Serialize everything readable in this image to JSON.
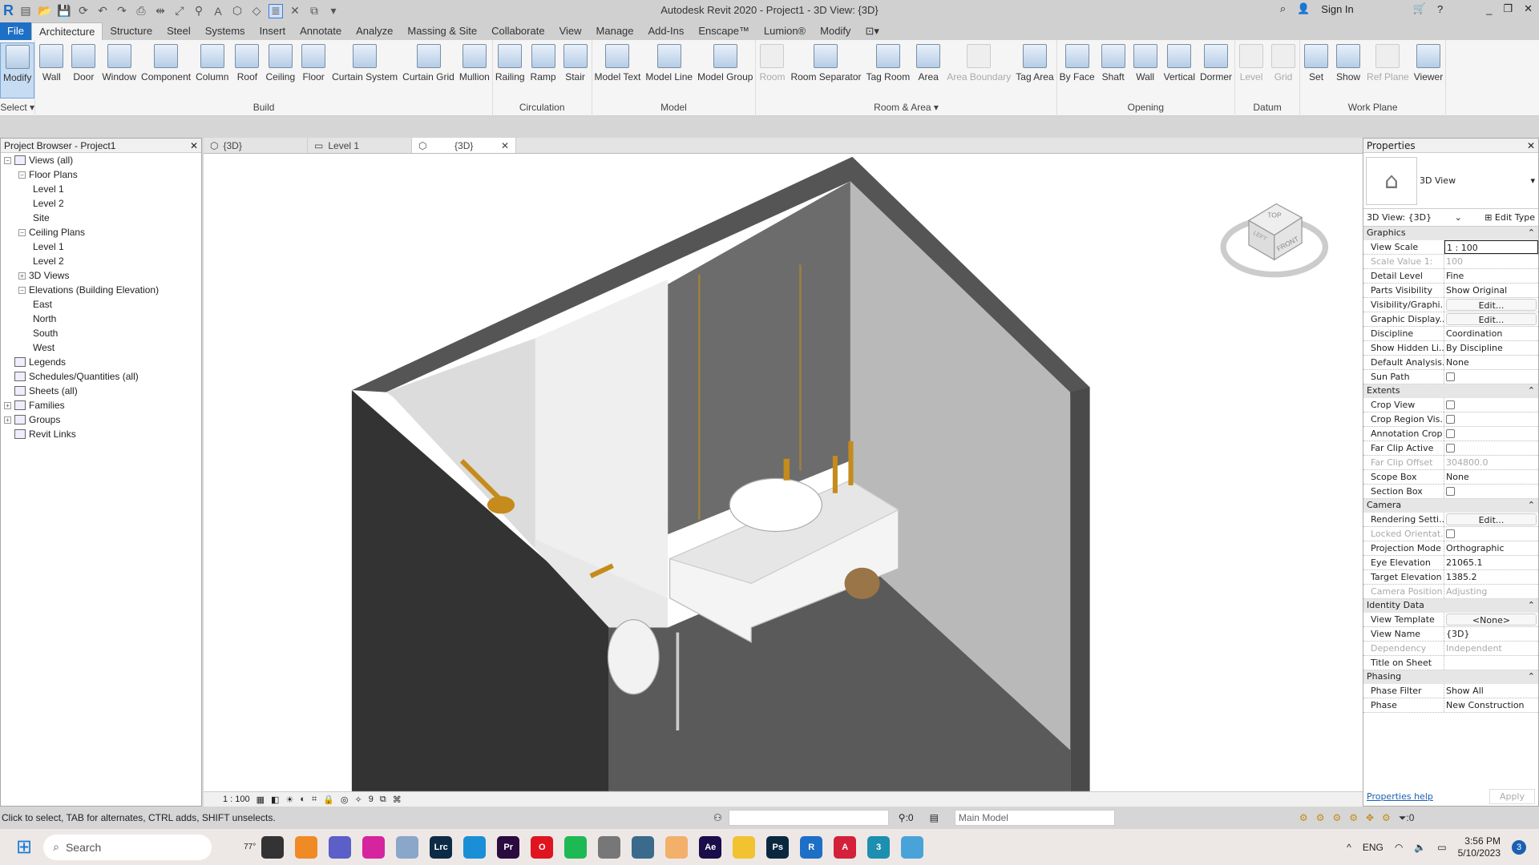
{
  "app_title": "Autodesk Revit 2020 - Project1 - 3D View: {3D}",
  "title_right": {
    "sign_in": "Sign In"
  },
  "tabs": [
    "File",
    "Architecture",
    "Structure",
    "Steel",
    "Systems",
    "Insert",
    "Annotate",
    "Analyze",
    "Massing & Site",
    "Collaborate",
    "View",
    "Manage",
    "Add-Ins",
    "Enscape™",
    "Lumion®",
    "Modify"
  ],
  "active_tab": "Architecture",
  "ribbon_groups": [
    {
      "label": "Select ▾",
      "items": [
        {
          "label": "Modify",
          "sel": true
        }
      ]
    },
    {
      "label": "Build",
      "items": [
        {
          "label": "Wall"
        },
        {
          "label": "Door"
        },
        {
          "label": "Window"
        },
        {
          "label": "Component"
        },
        {
          "label": "Column"
        },
        {
          "label": "Roof"
        },
        {
          "label": "Ceiling"
        },
        {
          "label": "Floor"
        },
        {
          "label": "Curtain System"
        },
        {
          "label": "Curtain Grid"
        },
        {
          "label": "Mullion"
        }
      ]
    },
    {
      "label": "Circulation",
      "items": [
        {
          "label": "Railing"
        },
        {
          "label": "Ramp"
        },
        {
          "label": "Stair"
        }
      ]
    },
    {
      "label": "Model",
      "items": [
        {
          "label": "Model Text"
        },
        {
          "label": "Model Line"
        },
        {
          "label": "Model Group"
        }
      ]
    },
    {
      "label": "Room & Area ▾",
      "items": [
        {
          "label": "Room",
          "dis": true
        },
        {
          "label": "Room Separator"
        },
        {
          "label": "Tag Room"
        },
        {
          "label": "Area"
        },
        {
          "label": "Area Boundary",
          "dis": true
        },
        {
          "label": "Tag Area"
        }
      ]
    },
    {
      "label": "Opening",
      "items": [
        {
          "label": "By Face"
        },
        {
          "label": "Shaft"
        },
        {
          "label": "Wall"
        },
        {
          "label": "Vertical"
        },
        {
          "label": "Dormer"
        }
      ]
    },
    {
      "label": "Datum",
      "items": [
        {
          "label": "Level",
          "dis": true
        },
        {
          "label": "Grid",
          "dis": true
        }
      ]
    },
    {
      "label": "Work Plane",
      "items": [
        {
          "label": "Set"
        },
        {
          "label": "Show"
        },
        {
          "label": "Ref Plane",
          "dis": true
        },
        {
          "label": "Viewer"
        }
      ]
    }
  ],
  "project_browser": {
    "title": "Project Browser - Project1",
    "items": [
      {
        "label": "Views (all)",
        "level": 0,
        "tog": "−"
      },
      {
        "label": "Floor Plans",
        "level": 1,
        "tog": "−"
      },
      {
        "label": "Level 1",
        "level": 2
      },
      {
        "label": "Level 2",
        "level": 2
      },
      {
        "label": "Site",
        "level": 2
      },
      {
        "label": "Ceiling Plans",
        "level": 1,
        "tog": "−"
      },
      {
        "label": "Level 1",
        "level": 2
      },
      {
        "label": "Level 2",
        "level": 2
      },
      {
        "label": "3D Views",
        "level": 1,
        "tog": "+"
      },
      {
        "label": "Elevations (Building Elevation)",
        "level": 1,
        "tog": "−"
      },
      {
        "label": "East",
        "level": 2
      },
      {
        "label": "North",
        "level": 2
      },
      {
        "label": "South",
        "level": 2
      },
      {
        "label": "West",
        "level": 2
      },
      {
        "label": "Legends",
        "level": 0,
        "icon": true
      },
      {
        "label": "Schedules/Quantities (all)",
        "level": 0,
        "icon": true
      },
      {
        "label": "Sheets (all)",
        "level": 0,
        "icon": true
      },
      {
        "label": "Families",
        "level": 0,
        "icon": true,
        "tog": "+"
      },
      {
        "label": "Groups",
        "level": 0,
        "icon": true,
        "tog": "+"
      },
      {
        "label": "Revit Links",
        "level": 0,
        "icon": true
      }
    ]
  },
  "view_tabs": [
    {
      "label": "{3D}"
    },
    {
      "label": "Level 1"
    },
    {
      "label": "{3D}",
      "active": true
    }
  ],
  "view_cube": {
    "top": "TOP",
    "front": "FRONT",
    "left": "LEFT"
  },
  "view_control": {
    "scale": "1 : 100",
    "detail": "9"
  },
  "properties": {
    "title": "Properties",
    "type_name": "3D View",
    "selector": "3D View: {3D}",
    "edit_type": "Edit Type",
    "sections": [
      {
        "name": "Graphics",
        "rows": [
          {
            "k": "View Scale",
            "v": "1 : 100",
            "t": "box"
          },
          {
            "k": "Scale Value    1:",
            "v": "100",
            "dim": true
          },
          {
            "k": "Detail Level",
            "v": "Fine"
          },
          {
            "k": "Parts Visibility",
            "v": "Show Original"
          },
          {
            "k": "Visibility/Graphi...",
            "v": "Edit...",
            "t": "btn"
          },
          {
            "k": "Graphic Display...",
            "v": "Edit...",
            "t": "btn"
          },
          {
            "k": "Discipline",
            "v": "Coordination"
          },
          {
            "k": "Show Hidden Li...",
            "v": "By Discipline"
          },
          {
            "k": "Default Analysis...",
            "v": "None"
          },
          {
            "k": "Sun Path",
            "v": "",
            "t": "chk"
          }
        ]
      },
      {
        "name": "Extents",
        "rows": [
          {
            "k": "Crop View",
            "v": "",
            "t": "chk"
          },
          {
            "k": "Crop Region Vis...",
            "v": "",
            "t": "chk"
          },
          {
            "k": "Annotation Crop",
            "v": "",
            "t": "chk"
          },
          {
            "k": "Far Clip Active",
            "v": "",
            "t": "chk"
          },
          {
            "k": "Far Clip Offset",
            "v": "304800.0",
            "dim": true
          },
          {
            "k": "Scope Box",
            "v": "None"
          },
          {
            "k": "Section Box",
            "v": "",
            "t": "chk"
          }
        ]
      },
      {
        "name": "Camera",
        "rows": [
          {
            "k": "Rendering Setti...",
            "v": "Edit...",
            "t": "btn"
          },
          {
            "k": "Locked Orientat...",
            "v": "",
            "t": "chk",
            "dim": true
          },
          {
            "k": "Projection Mode",
            "v": "Orthographic"
          },
          {
            "k": "Eye Elevation",
            "v": "21065.1"
          },
          {
            "k": "Target Elevation",
            "v": "1385.2"
          },
          {
            "k": "Camera Position",
            "v": "Adjusting",
            "dim": true
          }
        ]
      },
      {
        "name": "Identity Data",
        "rows": [
          {
            "k": "View Template",
            "v": "<None>",
            "t": "btn"
          },
          {
            "k": "View Name",
            "v": "{3D}"
          },
          {
            "k": "Dependency",
            "v": "Independent",
            "dim": true
          },
          {
            "k": "Title on Sheet",
            "v": ""
          }
        ]
      },
      {
        "name": "Phasing",
        "rows": [
          {
            "k": "Phase Filter",
            "v": "Show All"
          },
          {
            "k": "Phase",
            "v": "New Construction"
          }
        ]
      }
    ],
    "help": "Properties help",
    "apply": "Apply"
  },
  "status": {
    "message": "Click to select, TAB for alternates, CTRL adds, SHIFT unselects.",
    "workset_count": ":0",
    "model": "Main Model",
    "filter_count": ":0"
  },
  "taskbar": {
    "search": "Search",
    "weather": "77°",
    "apps": [
      {
        "t": "",
        "c": "#333"
      },
      {
        "t": "",
        "c": "#f08a24"
      },
      {
        "t": "",
        "c": "#5b5fc7"
      },
      {
        "t": "",
        "c": "#d6249f"
      },
      {
        "t": "",
        "c": "#8aa6c8"
      },
      {
        "t": "Lrc",
        "c": "#0d2b45"
      },
      {
        "t": "",
        "c": "#1a8fd8"
      },
      {
        "t": "Pr",
        "c": "#2a0a3f"
      },
      {
        "t": "O",
        "c": "#e0141e"
      },
      {
        "t": "",
        "c": "#1db954"
      },
      {
        "t": "",
        "c": "#777"
      },
      {
        "t": "",
        "c": "#3a6b8c"
      },
      {
        "t": "",
        "c": "#f2b06a"
      },
      {
        "t": "Ae",
        "c": "#1b0d4a"
      },
      {
        "t": "",
        "c": "#f2c230"
      },
      {
        "t": "Ps",
        "c": "#0a2740"
      },
      {
        "t": "R",
        "c": "#1e6fc6"
      },
      {
        "t": "A",
        "c": "#d3213a"
      },
      {
        "t": "3",
        "c": "#1d8fb0"
      },
      {
        "t": "",
        "c": "#4aa3d8"
      }
    ],
    "lang": "ENG",
    "time": "3:56 PM",
    "date": "5/10/2023",
    "badge": "3"
  }
}
